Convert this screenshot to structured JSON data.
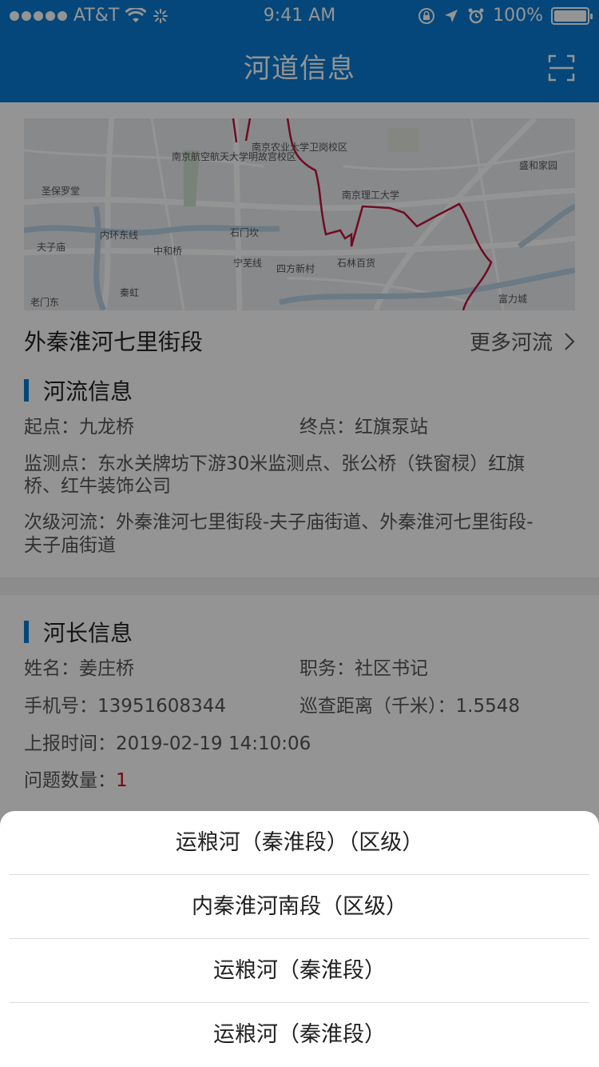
{
  "status_bar": {
    "carrier": "AT&T",
    "time": "9:41 AM",
    "battery": "100%"
  },
  "header": {
    "title": "河道信息"
  },
  "map": {
    "labels": [
      "南京航空航天大学明故宫校区",
      "南京农业大学卫岗校区",
      "盛和家园",
      "南京理工大学",
      "圣保罗堂",
      "夫子庙",
      "内环东线",
      "中和桥",
      "石门坎",
      "宁芜线",
      "四方新村",
      "石林百货",
      "秦虹",
      "老门东",
      "富力城"
    ]
  },
  "river": {
    "name": "外秦淮河七里街段",
    "more_label": "更多河流"
  },
  "river_info": {
    "section_title": "河流信息",
    "start": "起点：九龙桥",
    "end": "终点：红旗泵站",
    "monitor_line1": "监测点：东水关牌坊下游30米监测点、张公桥（铁窗棂）红旗",
    "monitor_line2": "桥、红牛装饰公司",
    "sub_line1": "次级河流：外秦淮河七里街段-夫子庙街道、外秦淮河七里街段-",
    "sub_line2": "夫子庙街道"
  },
  "chief_info": {
    "section_title": "河长信息",
    "name": "姓名：姜庄桥",
    "duty": "职务：社区书记",
    "phone": "手机号：13951608344",
    "distance": "巡查距离（千米）：1.5548",
    "report_time": "上报时间：2019-02-19 14:10:06",
    "issue_label": "问题数量：",
    "issue_count": "1"
  },
  "action_sheet": {
    "items": [
      "运粮河（秦淮段）（区级）",
      "内秦淮河南段（区级）",
      "运粮河（秦淮段）",
      "运粮河（秦淮段）"
    ]
  },
  "colors": {
    "brand": "#0a7bd2",
    "route": "#c0143c",
    "alert": "#d0021b"
  }
}
